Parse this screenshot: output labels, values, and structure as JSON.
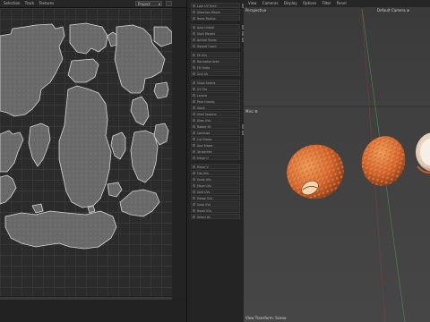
{
  "uv_editor": {
    "menu": [
      "Selection",
      "Track",
      "Textures"
    ],
    "dropdown_value": "Project"
  },
  "panel": {
    "items": [
      "Lock UV Shell",
      "Selection Whole",
      "Relax Radius",
      "Auto Unfold",
      "Shell Weight",
      "Anchor Points",
      "Repeat Count",
      "Fit UVs",
      "Normalize Area",
      "Fill Holes",
      "Grid UV",
      "Show Seams",
      "UV Tile",
      "Layout",
      "Pack Islands",
      "Stack",
      "Shell Spacing",
      "Align UVs",
      "Rotate 90",
      "Optimize",
      "Cut Edges",
      "Sew Edges",
      "Straighten",
      "Mirror U",
      "Mirror V",
      "Flip UVs",
      "Scale UVs",
      "Move UVs",
      "Split UVs",
      "Merge UVs",
      "Snap UVs",
      "Reset UVs",
      "Select All",
      "Unselect",
      "Pin UVs",
      "Unpin UVs",
      "Texture",
      "Unfold 3D",
      "Export"
    ]
  },
  "viewport": {
    "menu": [
      "View",
      "Cameras",
      "Display",
      "Options",
      "Filter",
      "Panel"
    ],
    "label": "Perspective",
    "camera": "Default Camera",
    "misc_label": "Misc",
    "status": "View Transform: Scene"
  },
  "colors": {
    "accent": "#e0662a",
    "island_fill": "#6a6a6a",
    "island_stroke": "#d8d8d8"
  }
}
